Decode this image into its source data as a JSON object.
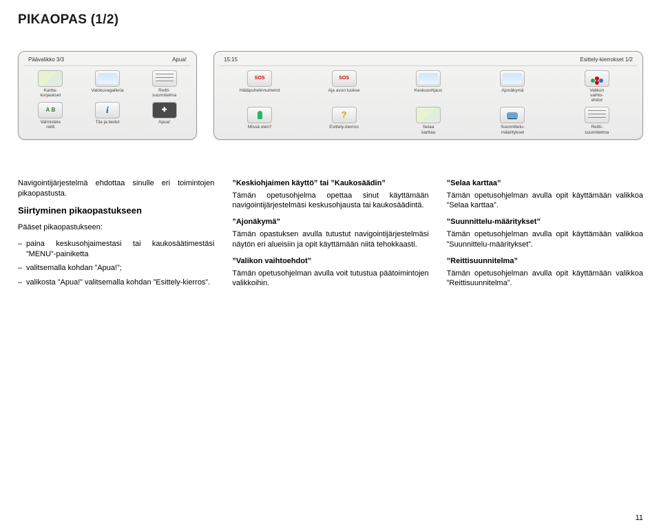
{
  "page": {
    "title": "PIKAOPAS (1/2)",
    "number": "11"
  },
  "screens": {
    "left": {
      "topleft": "Päävalikko 3/3",
      "topright": "Apua!",
      "row1": [
        {
          "name": "karttakorjaukset",
          "label": "Kartta-\nkorjaukset"
        },
        {
          "name": "valokuvagalleria",
          "label": "Valokuvagalleria"
        },
        {
          "name": "reittisuunnitelma",
          "label": "Reitti-\nsuunnitelma"
        }
      ],
      "row2": [
        {
          "name": "valmistele-reitti",
          "label": "Valmistele\nreitti"
        },
        {
          "name": "tila-ja-tiedot",
          "label": "Tila ja tiedot"
        },
        {
          "name": "apua",
          "label": "Apua!"
        }
      ]
    },
    "right": {
      "topleft": "15:15",
      "topright": "Esittely-kierrokset 1/2",
      "row1": [
        {
          "name": "hatapuhelinnumerot",
          "label": "Hätäpuhelinnumerot"
        },
        {
          "name": "aja-avun-luokse",
          "label": "Aja avun luokse"
        },
        {
          "name": "keskusohjaus",
          "label": "Keskusohjaus"
        },
        {
          "name": "ajonakyma",
          "label": "Ajonäkymä"
        },
        {
          "name": "valikon-vaihtoehdot",
          "label": "Valikon\nvaihto-\nehdot"
        }
      ],
      "row2": [
        {
          "name": "missa-olen",
          "label": "Missä olen?"
        },
        {
          "name": "esittely-kierros",
          "label": "Esittely-kierros"
        },
        {
          "name": "selaa-karttaa",
          "label": "Selaa\nkarttaa"
        },
        {
          "name": "suunnittelu-maaritykset",
          "label": "Suunnittelu-\nmääritykset"
        },
        {
          "name": "reittisuunnitelma2",
          "label": "Reitti-\nsuunnitelma"
        }
      ]
    }
  },
  "col1": {
    "intro": "Navigointijärjestelmä ehdottaa sinulle eri toimintojen pikaopastusta.",
    "h": "Siirtyminen pikaopastukseen",
    "lead": "Pääset pikaopastukseen:",
    "items": [
      "paina keskusohjaimestasi tai kaukosäätimestäsi ”MENU”-painiketta",
      "valitsemalla kohdan ”Apua!”;",
      "valikosta ”Apua!” valitsemalla kohdan ”Esittely-kierros”."
    ]
  },
  "col2": {
    "b1t": "”Keskiohjaimen käyttö” tai ”Kaukosäädin”",
    "b1p": "Tämän opetusohjelma opettaa sinut käyttämään navigointijärjestelmäsi keskusohjausta tai kaukosäädintä.",
    "b2t": "”Ajonäkymä”",
    "b2p": "Tämän opastuksen avulla tutustut navigointijärjestelmäsi näytön eri alueisiin ja opit käyttämään niitä tehokkaasti.",
    "b3t": "”Valikon vaihtoehdot”",
    "b3p": "Tämän opetusohjelman avulla voit tutustua päätoimintojen valikkoihin."
  },
  "col3": {
    "b1t": "”Selaa karttaa”",
    "b1p": "Tämän opetusohjelman avulla opit käyttämään valikkoa ”Selaa karttaa”.",
    "b2t": "”Suunnittelu-määritykset”",
    "b2p": "Tämän opetusohjelman avulla opit käyttämään valikkoa ”Suunnittelu-määritykset”.",
    "b3t": "”Reittisuunnitelma”",
    "b3p": "Tämän opetusohjelman avulla opit käyttämään valikkoa ”Reittisuunnitelma”."
  }
}
